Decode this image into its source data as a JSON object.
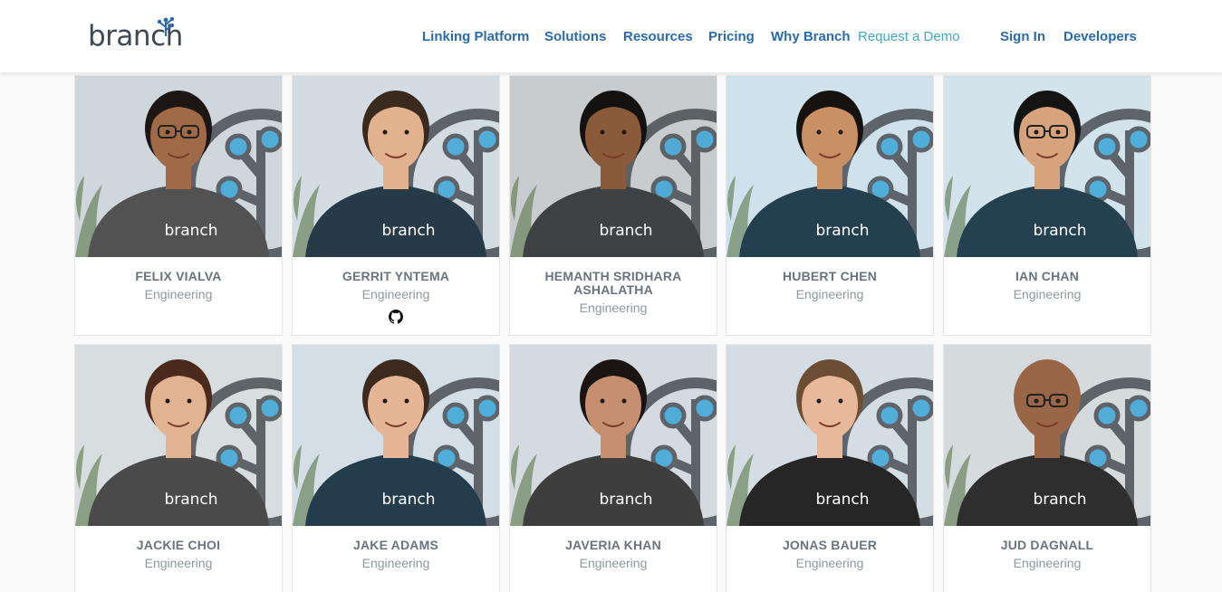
{
  "brand": {
    "name": "branch",
    "sprout_color": "#2a6bb0"
  },
  "nav": {
    "items": [
      {
        "label": "Linking Platform"
      },
      {
        "label": "Solutions"
      },
      {
        "label": "Resources"
      },
      {
        "label": "Pricing"
      },
      {
        "label": "Why Branch"
      },
      {
        "label": "Request a Demo"
      },
      {
        "label": "Sign In"
      },
      {
        "label": "Developers"
      }
    ]
  },
  "team": [
    {
      "name": "FELIX VIALVA",
      "dept": "Engineering",
      "photo": {
        "bg": "#cfd6dc",
        "skin": "#a06a46",
        "hair": "#1c1714",
        "shirt": "#525252",
        "shirt_text": "branch",
        "glasses": true
      }
    },
    {
      "name": "GERRIT YNTEMA",
      "dept": "Engineering",
      "github": "github-icon",
      "photo": {
        "bg": "#d4dce3",
        "skin": "#e2b18e",
        "hair": "#3a2a1e",
        "shirt": "#263a48",
        "shirt_text": "branch",
        "glasses": false
      }
    },
    {
      "name": "HEMANTH SRIDHARA ASHALATHA",
      "dept": "Engineering",
      "photo": {
        "bg": "#c9ccce",
        "skin": "#8a5a3a",
        "hair": "#141210",
        "shirt": "#3f4245",
        "shirt_text": "branch",
        "glasses": false
      }
    },
    {
      "name": "HUBERT CHEN",
      "dept": "Engineering",
      "photo": {
        "bg": "#cfe2ec",
        "skin": "#c98f65",
        "hair": "#151210",
        "shirt": "#24404e",
        "shirt_text": "branch",
        "glasses": false
      }
    },
    {
      "name": "IAN CHAN",
      "dept": "Engineering",
      "photo": {
        "bg": "#d2e3ec",
        "skin": "#d6a37c",
        "hair": "#141414",
        "shirt": "#25404e",
        "shirt_text": "branch",
        "glasses": true
      }
    },
    {
      "name": "JACKIE CHOI",
      "dept": "Engineering",
      "photo": {
        "bg": "#d8dde0",
        "skin": "#e2b391",
        "hair": "#4a2a1c",
        "shirt": "#4a4a4a",
        "shirt_text": "branch",
        "glasses": false
      }
    },
    {
      "name": "JAKE ADAMS",
      "dept": "Engineering",
      "photo": {
        "bg": "#d3dee6",
        "skin": "#e6b595",
        "hair": "#3c2a1e",
        "shirt": "#233d4c",
        "shirt_text": "branch",
        "glasses": false
      }
    },
    {
      "name": "JAVERIA KHAN",
      "dept": "Engineering",
      "photo": {
        "bg": "#d4dadf",
        "skin": "#c69070",
        "hair": "#1a1412",
        "shirt": "#3e3e3e",
        "shirt_text": "branch",
        "glasses": false
      }
    },
    {
      "name": "JONAS BAUER",
      "dept": "Engineering",
      "photo": {
        "bg": "#d4dde3",
        "skin": "#e7b899",
        "hair": "#6b4e34",
        "shirt": "#262626",
        "shirt_text": "branch",
        "glasses": false
      }
    },
    {
      "name": "JUD DAGNALL",
      "dept": "Engineering",
      "photo": {
        "bg": "#d5dadd",
        "skin": "#9a6648",
        "hair": "#9a6648",
        "shirt": "#2e2e2e",
        "shirt_text": "branch",
        "glasses": true
      }
    }
  ]
}
